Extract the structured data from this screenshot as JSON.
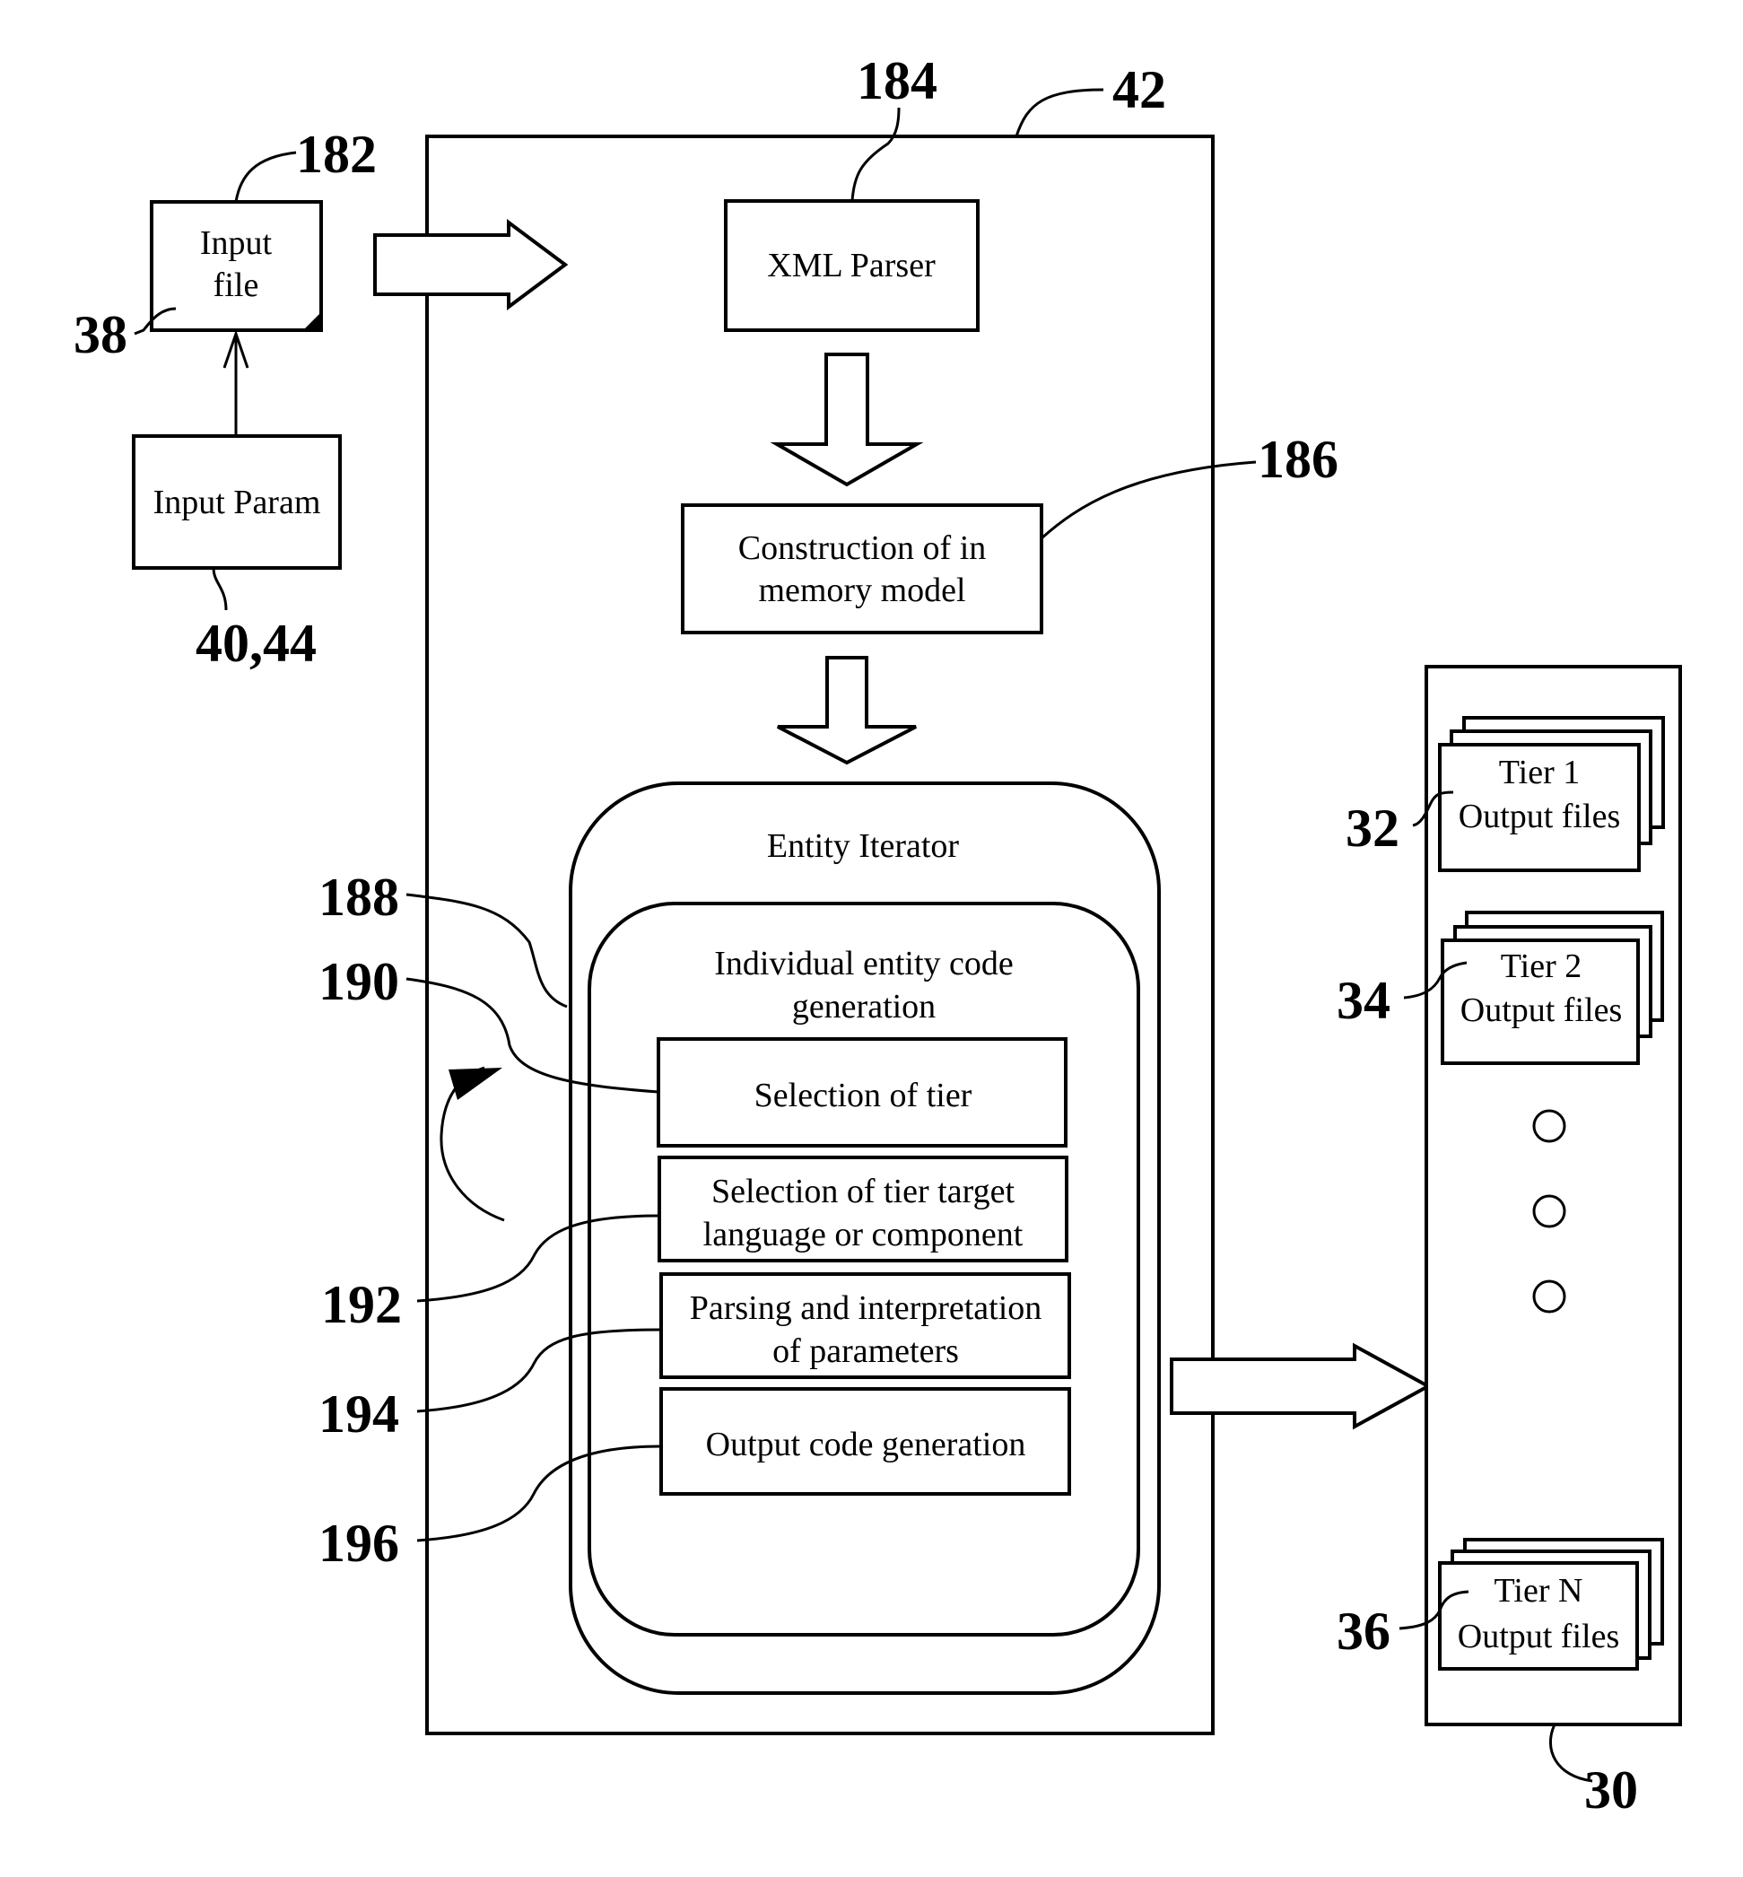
{
  "figure": {
    "main_block": {
      "ref": "42"
    },
    "input_file": {
      "ref": "182",
      "ref_side": "38",
      "lines": [
        "Input",
        "file"
      ]
    },
    "input_param": {
      "ref": "40,44",
      "label": "Input Param"
    },
    "xml_parser": {
      "ref": "184",
      "label": "XML Parser"
    },
    "memory_model": {
      "ref": "186",
      "lines": [
        "Construction of in",
        "memory model"
      ]
    },
    "entity_iterator": {
      "ref": "188",
      "label": "Entity Iterator"
    },
    "entity_codegen": {
      "ref": "190",
      "lines": [
        "Individual entity code",
        "generation"
      ]
    },
    "steps": [
      {
        "ref": "190",
        "lines": [
          "Selection of tier"
        ]
      },
      {
        "ref": "192",
        "lines": [
          "Selection of tier target",
          "language or component"
        ]
      },
      {
        "ref": "194",
        "lines": [
          "Parsing and interpretation",
          "of parameters"
        ]
      },
      {
        "ref": "196",
        "lines": [
          "Output code generation"
        ]
      }
    ],
    "output_panel": {
      "ref": "30",
      "tiers": [
        {
          "ref": "32",
          "lines": [
            "Tier 1",
            "Output files"
          ]
        },
        {
          "ref": "34",
          "lines": [
            "Tier 2",
            "Output files"
          ]
        },
        {
          "ref": "36",
          "lines": [
            "Tier N",
            "Output files"
          ]
        }
      ],
      "ellipsis_count": 3
    }
  }
}
